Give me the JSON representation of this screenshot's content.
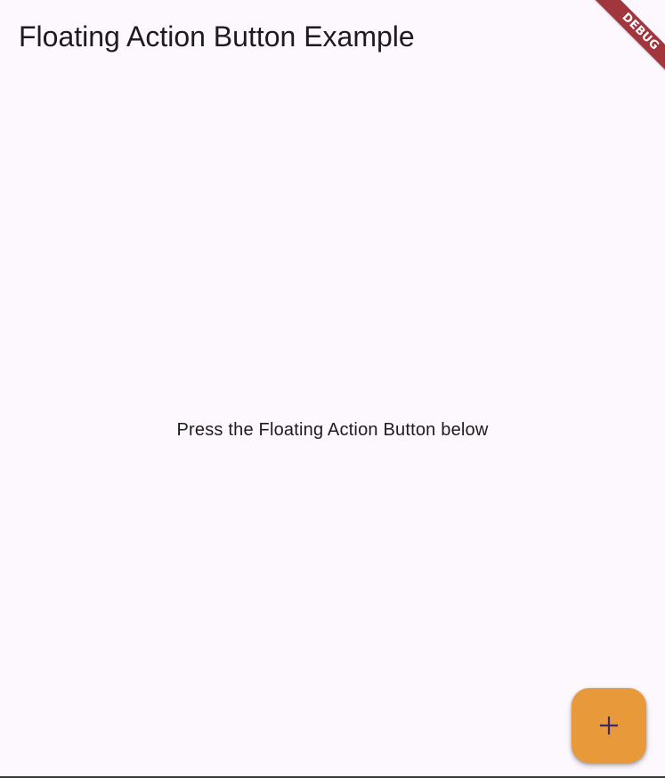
{
  "app_bar": {
    "title": "Floating Action Button Example"
  },
  "body": {
    "message": "Press the Floating Action Button below"
  },
  "fab": {
    "icon": "add-icon",
    "color": "#e8993a",
    "icon_color": "#3b2a6e"
  },
  "debug_banner": {
    "label": "DEBUG",
    "color": "#a1363d"
  },
  "colors": {
    "background": "#fdf7fe",
    "text": "#1d1b20"
  }
}
